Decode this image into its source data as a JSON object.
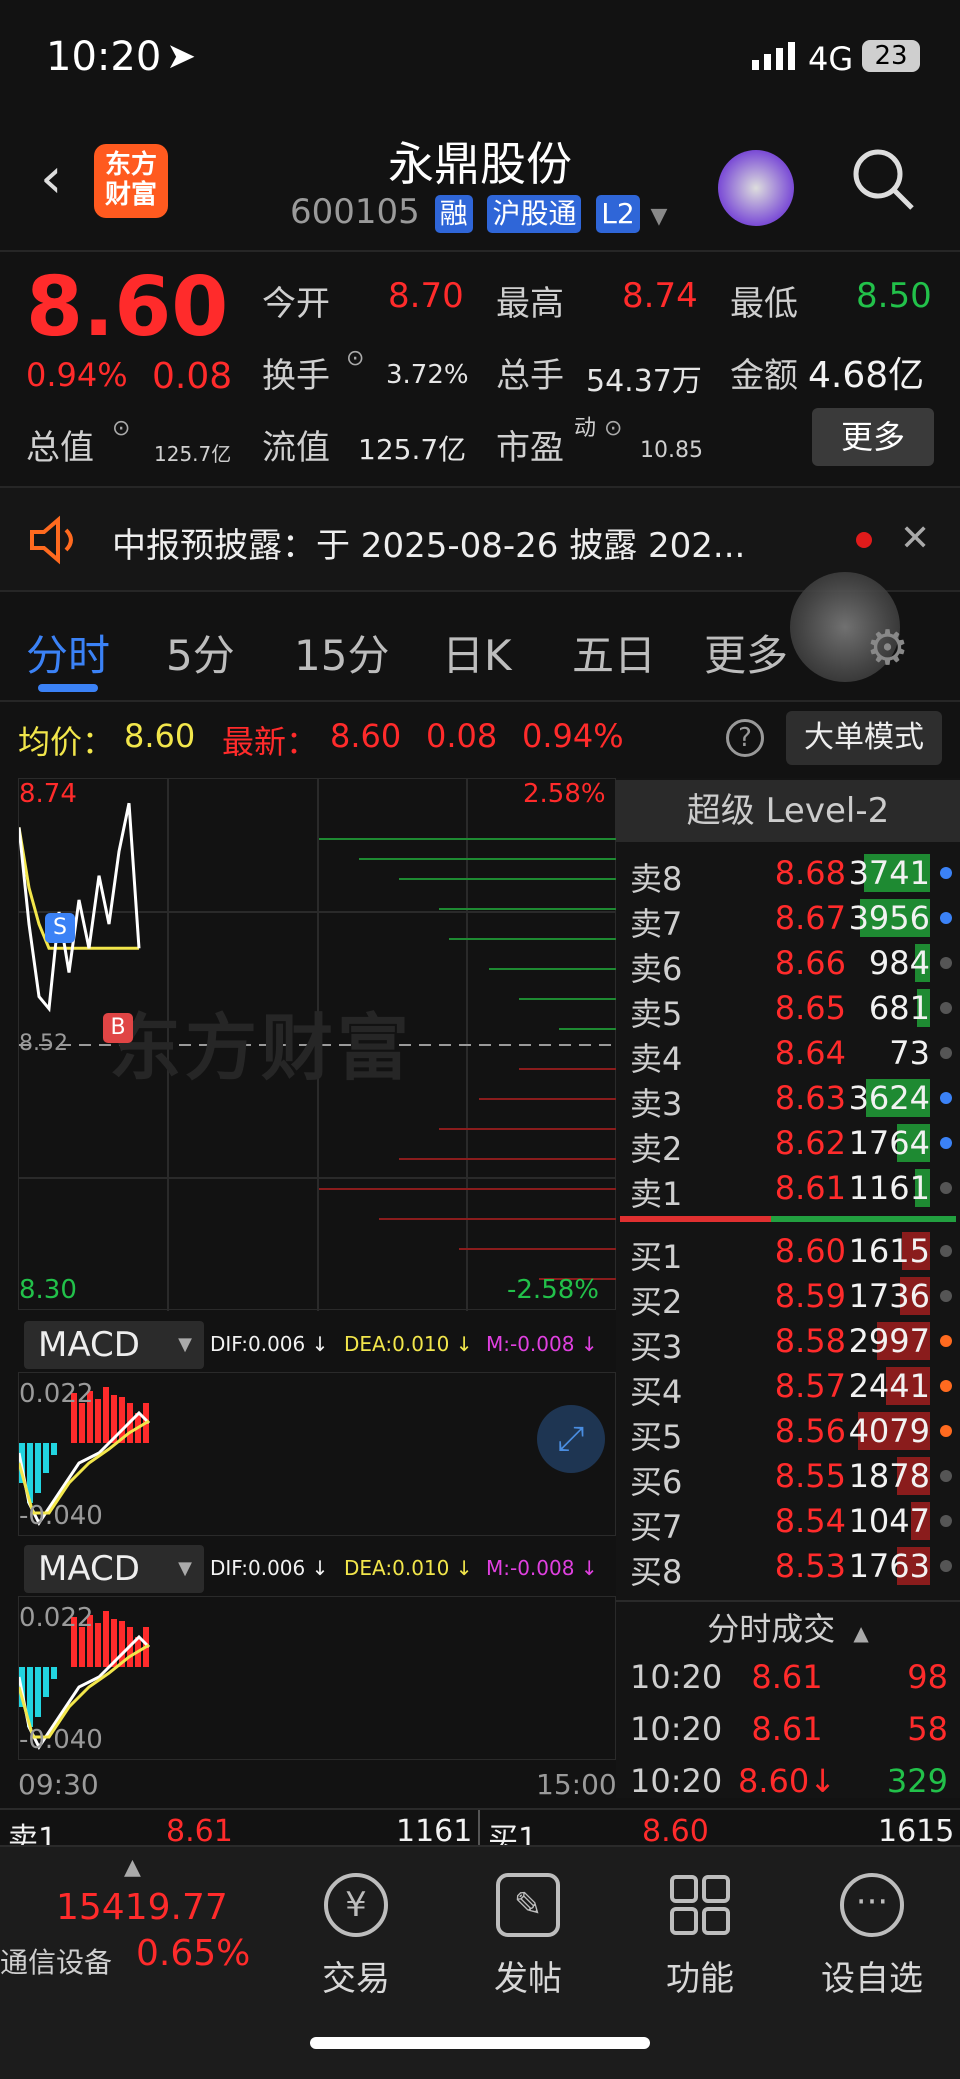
{
  "status": {
    "time": "10:20",
    "network": "4G",
    "battery": "23"
  },
  "nav": {
    "logo_line1": "东方",
    "logo_line2": "财富",
    "stock_name": "永鼎股份",
    "stock_code": "600105",
    "tag1": "融",
    "tag2": "沪股通",
    "tag3": "L2"
  },
  "quote": {
    "price": "8.60",
    "pct": "0.94%",
    "chg": "0.08",
    "open_label": "今开",
    "open": "8.70",
    "high_label": "最高",
    "high": "8.74",
    "low_label": "最低",
    "low": "8.50",
    "turnover_label": "换手",
    "turnover": "3.72%",
    "volume_label": "总手",
    "volume": "54.37万",
    "amount_label": "金额",
    "amount": "4.68亿",
    "mktcap_label": "总值",
    "mktcap": "125.7亿",
    "float_label": "流值",
    "float": "125.7亿",
    "pe_label": "市盈",
    "pe_sup": "动",
    "pe": "10.85",
    "more_btn": "更多"
  },
  "notice": {
    "text": "中报预披露：于 2025-08-26 披露 202..."
  },
  "tabs": [
    "分时",
    "5分",
    "15分",
    "日K",
    "五日",
    "更多"
  ],
  "avgbar": {
    "avg_label": "均价：",
    "avg": "8.60",
    "latest_label": "最新：",
    "latest": "8.60",
    "latest_chg": "0.08",
    "latest_pct": "0.94%",
    "bigorder": "大单模式"
  },
  "chart_data": {
    "type": "line",
    "title": "",
    "y_high": "8.74",
    "y_low": "8.30",
    "pct_high": "2.58%",
    "pct_low": "-2.58%",
    "ref_label": "8.52",
    "x_start": "09:30",
    "x_end": "15:00",
    "price": [
      8.7,
      8.62,
      8.56,
      8.55,
      8.63,
      8.58,
      8.64,
      8.6,
      8.66,
      8.62,
      8.68,
      8.72,
      8.6
    ],
    "avg": [
      8.7,
      8.65,
      8.62,
      8.6,
      8.6,
      8.6,
      8.6,
      8.6,
      8.6,
      8.6,
      8.6,
      8.6,
      8.6
    ],
    "markers": [
      {
        "label": "S",
        "value": 8.64
      },
      {
        "label": "B",
        "value": 8.58
      }
    ],
    "watermark": "东方财富"
  },
  "macd": {
    "label": "MACD",
    "dif": "DIF:0.006 ↓",
    "dea": "DEA:0.010 ↓",
    "m": "M:-0.008 ↓",
    "top": "0.022",
    "bottom": "-0.040"
  },
  "book": {
    "title": "超级 Level-2",
    "sells": [
      {
        "l": "卖8",
        "p": "8.68",
        "v": "3741",
        "bar": 0.6
      },
      {
        "l": "卖7",
        "p": "8.67",
        "v": "3956",
        "bar": 0.64
      },
      {
        "l": "卖6",
        "p": "8.66",
        "v": "984",
        "bar": 0.14
      },
      {
        "l": "卖5",
        "p": "8.65",
        "v": "681",
        "bar": 0.12
      },
      {
        "l": "卖4",
        "p": "8.64",
        "v": "73",
        "bar": 0
      },
      {
        "l": "卖3",
        "p": "8.63",
        "v": "3624",
        "bar": 0.58
      },
      {
        "l": "卖2",
        "p": "8.62",
        "v": "1764",
        "bar": 0.3
      },
      {
        "l": "卖1",
        "p": "8.61",
        "v": "1161",
        "bar": 0.14
      }
    ],
    "buys": [
      {
        "l": "买1",
        "p": "8.60",
        "v": "1615",
        "bar": 0.25
      },
      {
        "l": "买2",
        "p": "8.59",
        "v": "1736",
        "bar": 0.27
      },
      {
        "l": "买3",
        "p": "8.58",
        "v": "2997",
        "bar": 0.48
      },
      {
        "l": "买4",
        "p": "8.57",
        "v": "2441",
        "bar": 0.4
      },
      {
        "l": "买5",
        "p": "8.56",
        "v": "4079",
        "bar": 0.65
      },
      {
        "l": "买6",
        "p": "8.55",
        "v": "1878",
        "bar": 0.3
      },
      {
        "l": "买7",
        "p": "8.54",
        "v": "1047",
        "bar": 0.17
      },
      {
        "l": "买8",
        "p": "8.53",
        "v": "1763",
        "bar": 0.3
      }
    ],
    "trades_title": "分时成交",
    "trades": [
      {
        "t": "10:20",
        "p": "8.61",
        "v": "98"
      },
      {
        "t": "10:20",
        "p": "8.61",
        "v": "58"
      },
      {
        "t": "10:20",
        "p": "8.60↓",
        "v": "329"
      }
    ]
  },
  "strip": {
    "s1": "卖1",
    "s1p": "8.61",
    "s1v": "1161",
    "b1": "买1",
    "b1p": "8.60",
    "b1v": "1615"
  },
  "bottom": {
    "index": "15419.77",
    "sector": "通信设备",
    "sector_pct": "0.65%",
    "items": [
      "交易",
      "发帖",
      "功能",
      "设自选"
    ]
  }
}
